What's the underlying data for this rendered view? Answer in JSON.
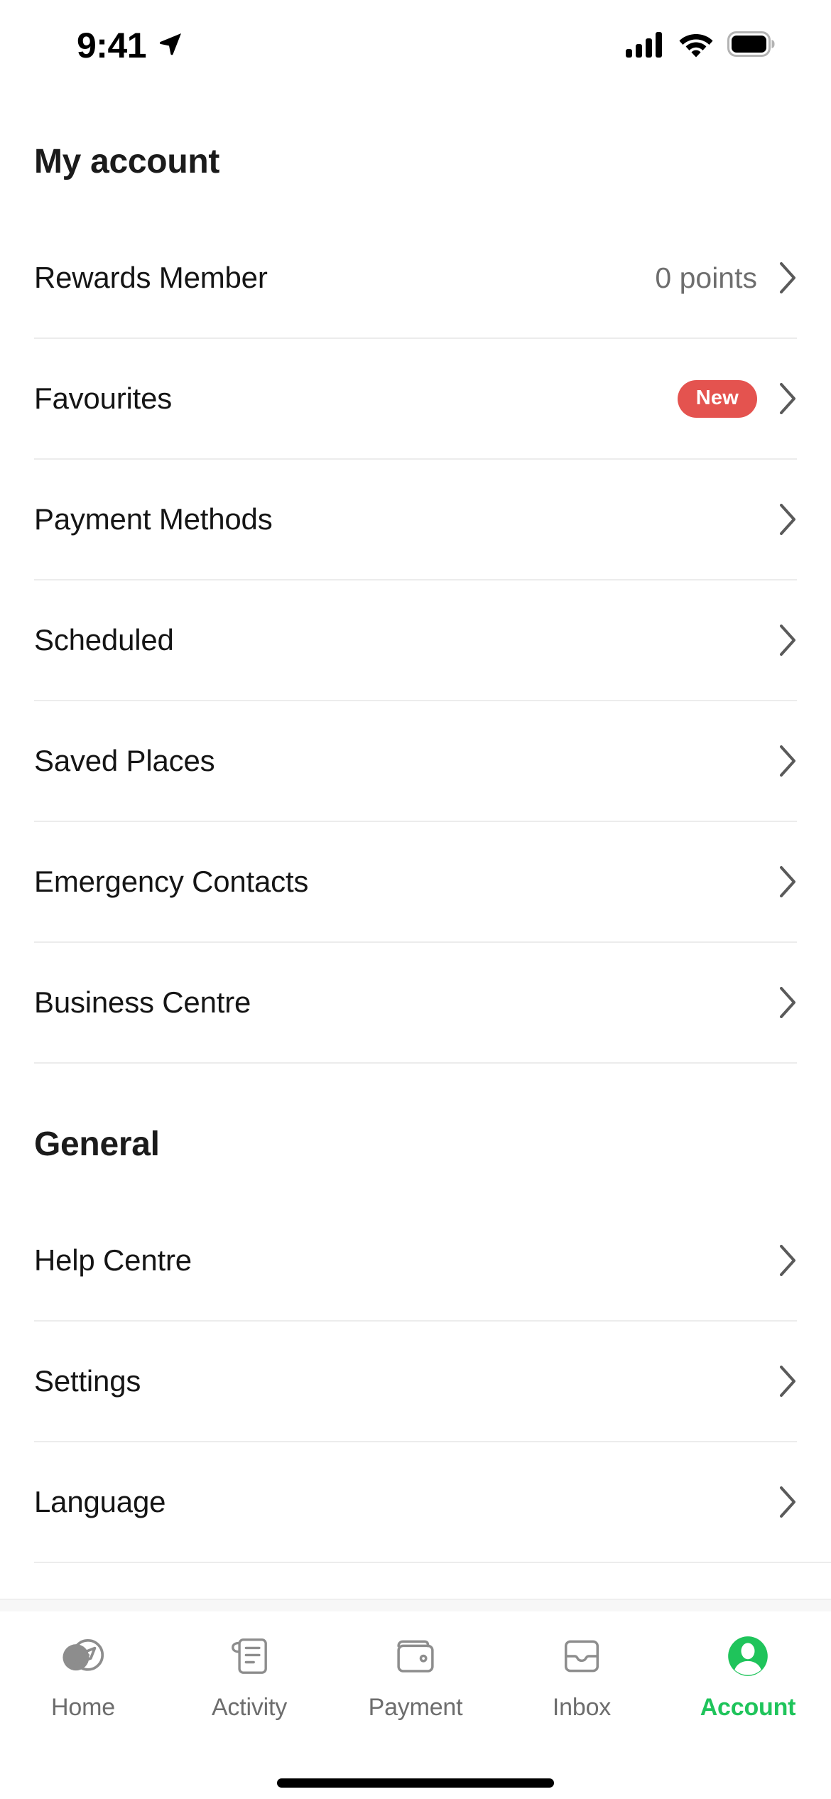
{
  "status_bar": {
    "time": "9:41",
    "location_icon": "location-arrow-icon",
    "cellular_icon": "cellular-signal-icon",
    "wifi_icon": "wifi-icon",
    "battery_icon": "battery-full-icon"
  },
  "theme": {
    "accent_green": "#1FC45B",
    "badge_red": "#E4534F",
    "text_primary": "#151515",
    "text_secondary": "#6E6E6E",
    "divider": "#ECECEC"
  },
  "sections": [
    {
      "title": "My account",
      "items": [
        {
          "label": "Rewards Member",
          "value": "0 points",
          "badge": null,
          "chevron": true
        },
        {
          "label": "Favourites",
          "value": null,
          "badge": "New",
          "chevron": true
        },
        {
          "label": "Payment Methods",
          "value": null,
          "badge": null,
          "chevron": true
        },
        {
          "label": "Scheduled",
          "value": null,
          "badge": null,
          "chevron": true
        },
        {
          "label": "Saved Places",
          "value": null,
          "badge": null,
          "chevron": true
        },
        {
          "label": "Emergency Contacts",
          "value": null,
          "badge": null,
          "chevron": true
        },
        {
          "label": "Business Centre",
          "value": null,
          "badge": null,
          "chevron": true
        }
      ]
    },
    {
      "title": "General",
      "items": [
        {
          "label": "Help Centre",
          "value": null,
          "badge": null,
          "chevron": true
        },
        {
          "label": "Settings",
          "value": null,
          "badge": null,
          "chevron": true
        },
        {
          "label": "Language",
          "value": null,
          "badge": null,
          "chevron": true
        }
      ]
    }
  ],
  "tabbar": {
    "items": [
      {
        "label": "Home",
        "icon": "compass-icon",
        "active": false
      },
      {
        "label": "Activity",
        "icon": "receipt-icon",
        "active": false
      },
      {
        "label": "Payment",
        "icon": "wallet-icon",
        "active": false
      },
      {
        "label": "Inbox",
        "icon": "inbox-tray-icon",
        "active": false
      },
      {
        "label": "Account",
        "icon": "account-avatar-icon",
        "active": true
      }
    ]
  }
}
